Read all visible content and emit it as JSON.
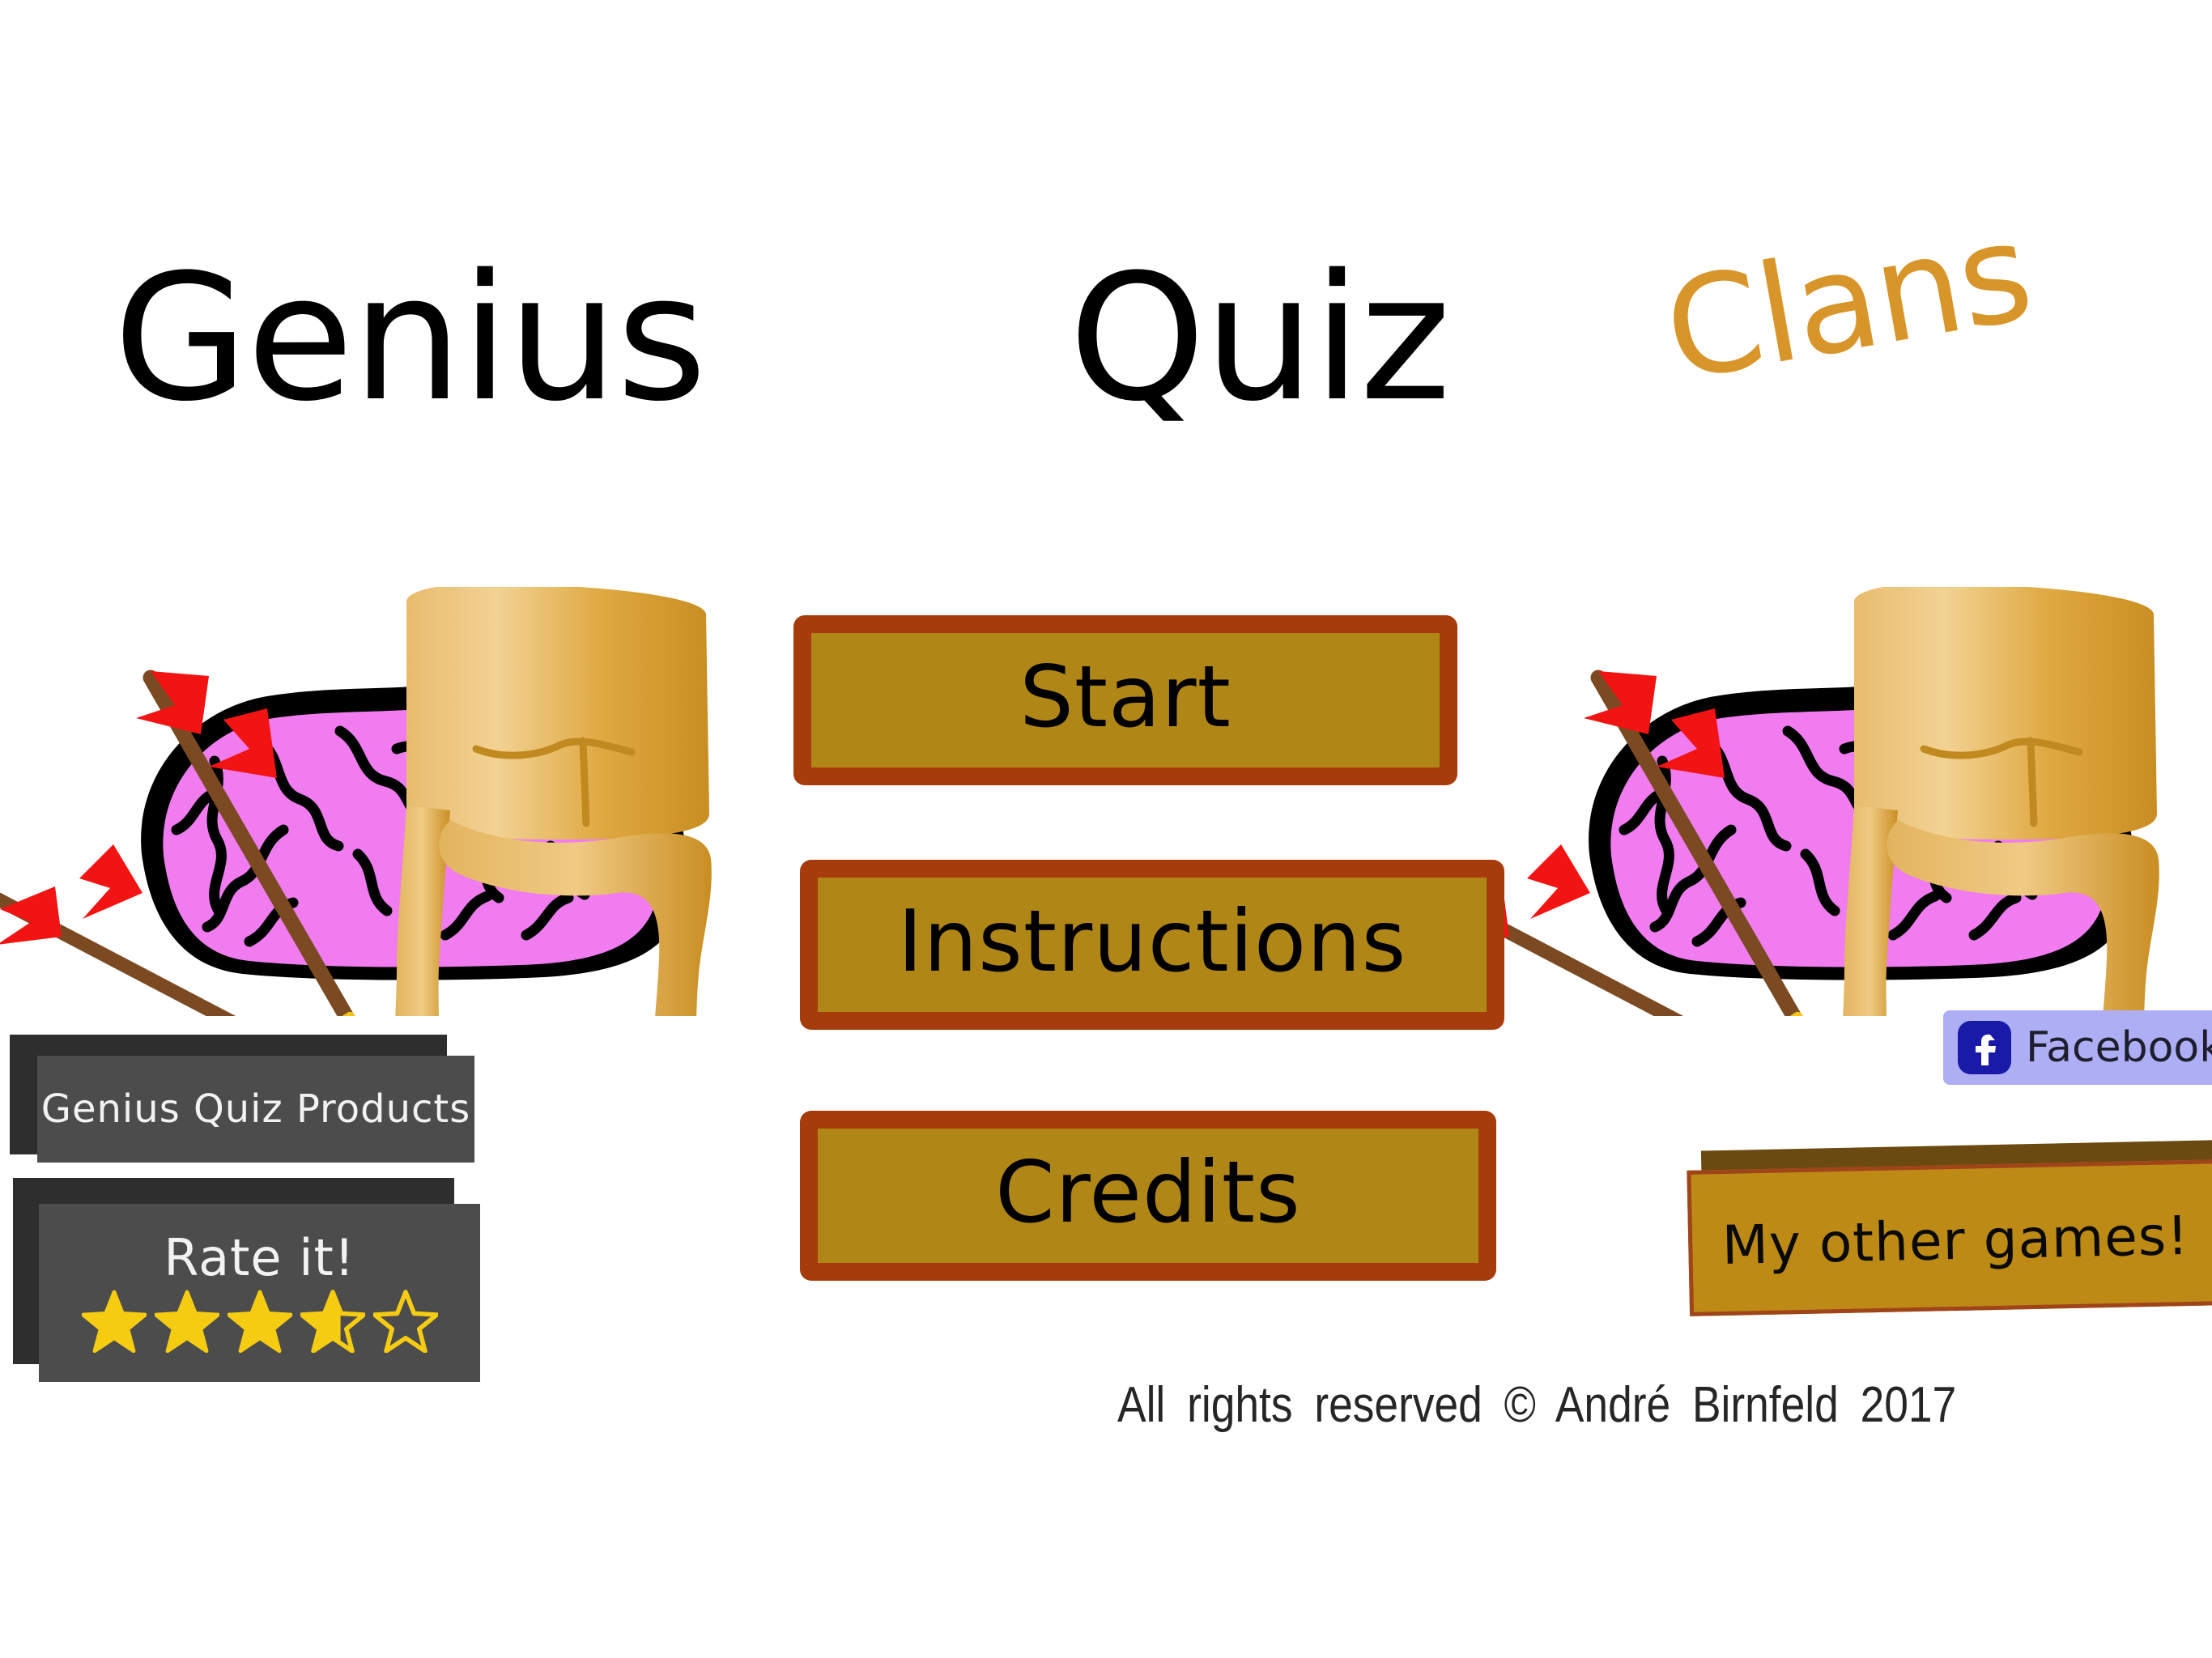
{
  "title": {
    "word1": "Genius",
    "word2": "Quiz",
    "word3": "Clans",
    "accent_color": "#D8952A",
    "text_color": "#000000"
  },
  "menu": {
    "buttons": [
      {
        "label": "Start"
      },
      {
        "label": "Instructions"
      },
      {
        "label": "Credits"
      }
    ],
    "fill_color": "#B08616",
    "border_color": "#A63C0C"
  },
  "promo": {
    "products_label": "Genius Quiz Products",
    "rate_label": "Rate it!",
    "panel_front_color": "#4C4C4C",
    "panel_back_color": "#2E2E2E",
    "rating": {
      "filled": 3,
      "partial_fraction": 0.62,
      "total": 5,
      "star_color": "#F5CC11"
    }
  },
  "social": {
    "facebook_label": "Facebook",
    "facebook_bg": "#AEAEF5",
    "facebook_icon_bg": "#1A1AA8"
  },
  "other_games": {
    "label": "My other games!",
    "fill_color": "#BD8A16",
    "border_color": "#A0441A"
  },
  "footer": {
    "copyright": "All   rights   reserved  ©   André Birnfeld 2017"
  },
  "artwork": {
    "brain_fill": "#F07CF0",
    "brain_outline": "#000000",
    "honey_light": "#F0C878",
    "honey_mid": "#D9A23C",
    "honey_dark": "#C08A20",
    "arrow_shaft": "#7B4A22",
    "arrow_fletch": "#F21313",
    "arrow_tip": "#F2C411"
  }
}
